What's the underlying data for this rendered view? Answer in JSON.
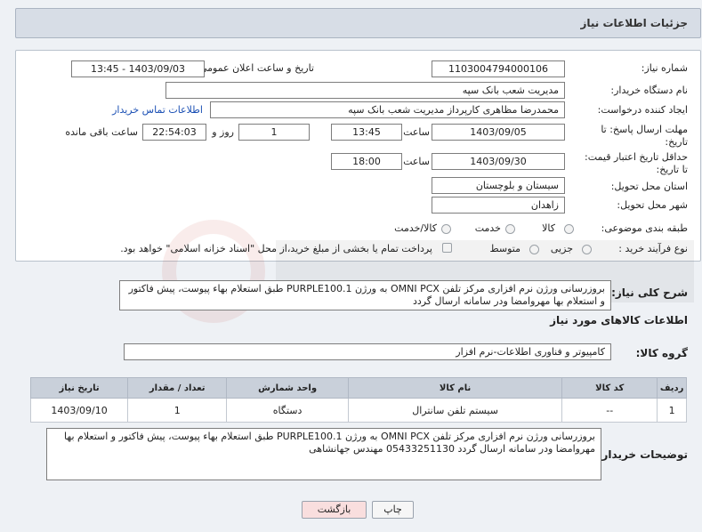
{
  "header": {
    "title": "جزئیات اطلاعات نیاز"
  },
  "form": {
    "need_number_label": "شماره نیاز:",
    "need_number": "1103004794000106",
    "announce_label": "تاریخ و ساعت اعلان عمومی:",
    "announce_value": "1403/09/03 - 13:45",
    "buyer_org_label": "نام دستگاه خریدار:",
    "buyer_org": "مدیریت شعب بانک سپه",
    "creator_label": "ایجاد کننده درخواست:",
    "creator": "محمدرضا مظاهری کارپرداز مدیریت شعب بانک سپه",
    "contact_link": "اطلاعات تماس خریدار",
    "deadline_label": "مهلت ارسال پاسخ: تا تاریخ:",
    "deadline_date": "1403/09/05",
    "time_label": "ساعت",
    "deadline_time": "13:45",
    "days_value": "1",
    "days_label": "روز و",
    "remaining_time": "22:54:03",
    "remaining_label": "ساعت باقی مانده",
    "validity_label": "حداقل تاریخ اعتبار قیمت: تا تاریخ:",
    "validity_date": "1403/09/30",
    "validity_time": "18:00",
    "province_label": "استان محل تحویل:",
    "province": "سیستان و بلوچستان",
    "city_label": "شهر محل تحویل:",
    "city": "زاهدان",
    "category_label": "طبقه بندی موضوعی:",
    "category_options": [
      "کالا",
      "خدمت",
      "کالا/خدمت"
    ],
    "process_label": "نوع فرآیند خرید :",
    "process_options": [
      "جزیی",
      "متوسط"
    ],
    "payment_note": "پرداخت تمام یا بخشی از مبلغ خرید،از محل \"اسناد خزانه اسلامی\" خواهد بود."
  },
  "summary": {
    "label": "شرح کلی نیاز:",
    "text": "بروزرسانی ورژن نرم افزاری مرکز تلفن OMNI PCX به ورژن PURPLE100.1 طبق استعلام بهاء پیوست، پیش فاکتور و استعلام بها مهروامضا ودر سامانه ارسال گردد"
  },
  "goods": {
    "heading": "اطلاعات کالاهای مورد نیاز",
    "group_label": "گروه کالا:",
    "group_value": "کامپیوتر و فناوری اطلاعات-نرم افزار",
    "columns": [
      "ردیف",
      "کد کالا",
      "نام کالا",
      "واحد شمارش",
      "تعداد / مقدار",
      "تاریخ نیاز"
    ],
    "rows": [
      {
        "row": "1",
        "code": "--",
        "name": "سیستم تلفن سانترال",
        "unit": "دستگاه",
        "qty": "1",
        "date": "1403/09/10"
      }
    ]
  },
  "buyer_notes": {
    "label": "توضیحات خریدار:",
    "text": "بروزرسانی ورژن نرم افزاری مرکز تلفن OMNI PCX به ورژن PURPLE100.1 طبق استعلام بهاء پیوست، پیش فاکتور و استعلام بها مهروامضا ودر سامانه ارسال گردد 05433251130 مهندس جهانشاهی"
  },
  "buttons": {
    "print": "چاپ",
    "back": "بازگشت"
  },
  "colors": {
    "header_bg": "#d7dde6",
    "back_button_bg": "#f9dede",
    "link": "#1a4fb4",
    "table_header": "#c9d0da"
  }
}
